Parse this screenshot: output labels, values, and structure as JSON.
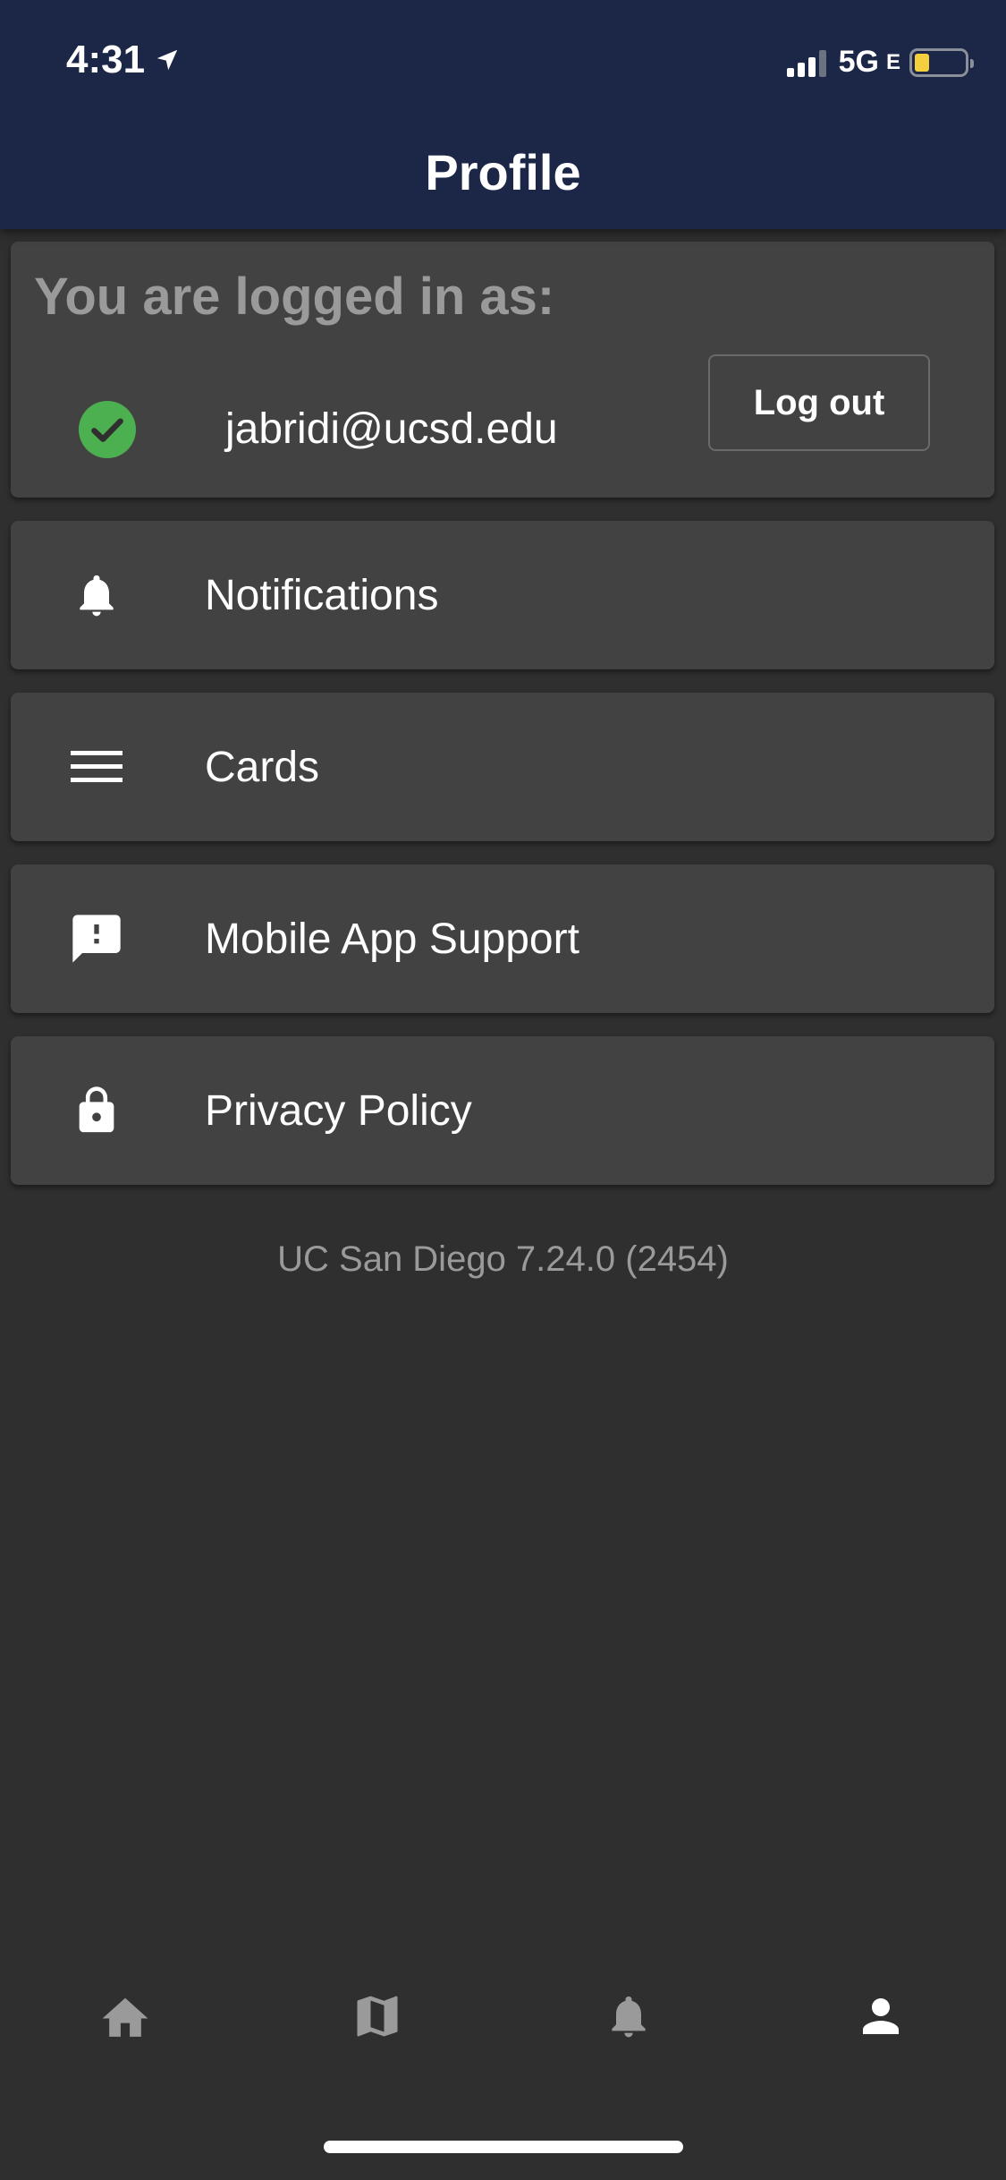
{
  "status_bar": {
    "time": "4:31",
    "network": "5G",
    "network_sub": "E"
  },
  "header": {
    "title": "Profile"
  },
  "account": {
    "heading": "You are logged in as:",
    "email": "jabridi@ucsd.edu",
    "logout_label": "Log out",
    "status_color": "#4caf50"
  },
  "menu": {
    "items": [
      {
        "label": "Notifications",
        "icon": "bell-icon"
      },
      {
        "label": "Cards",
        "icon": "menu-lines-icon"
      },
      {
        "label": "Mobile App Support",
        "icon": "feedback-icon"
      },
      {
        "label": "Privacy Policy",
        "icon": "lock-icon"
      }
    ]
  },
  "footer": {
    "version": "UC San Diego 7.24.0 (2454)"
  },
  "bottom_nav": {
    "items": [
      {
        "icon": "home-icon",
        "active": false
      },
      {
        "icon": "map-icon",
        "active": false
      },
      {
        "icon": "bell-icon",
        "active": false
      },
      {
        "icon": "person-icon",
        "active": true
      }
    ]
  },
  "colors": {
    "header_bg": "#1c2747",
    "page_bg": "#2f2f2f",
    "card_bg": "#424242",
    "muted_text": "#9a9a9a"
  }
}
